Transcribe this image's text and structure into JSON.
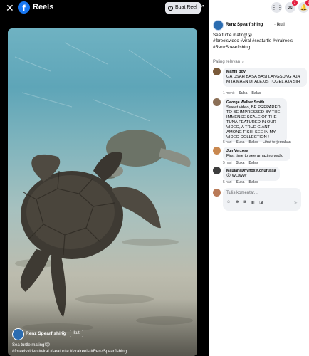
{
  "topbar": {
    "app_logo_letter": "f",
    "title": "Reels",
    "create_reel_label": "Buat Reel"
  },
  "right_topbar": {
    "notifications_badge": "1",
    "messenger_badge": "1"
  },
  "video": {
    "author": "Renz Spearfishing",
    "follow_label": "Ikuti",
    "caption_line1": "Sea turtle mating!😲",
    "caption_line2": "#fbreelsvideo #viral #seaturtle #viralreels #RenzSpearfishing"
  },
  "post": {
    "author": "Renz Spearfishing",
    "follow_label": "Ikuti",
    "caption_line1": "Sea turtle mating!😲",
    "caption_line2": "#fbreelsvideo #viral #seaturtle #viralreels",
    "caption_line3": "#RenzSpearfishing"
  },
  "comments_section": {
    "sort_label": "Paling relevan"
  },
  "comments": [
    {
      "name": "Mahfil Boy",
      "text": "GA USAH BASA BASI LANGSUNG AJA KITA MAEN DI ALEXIS TOGEL AJA SIH",
      "time": "1 menit",
      "like": "Suka",
      "reply": "Balas",
      "extra": ""
    },
    {
      "name": "George Walker Smith",
      "text": "Sweet video, BE PREPARED TO BE IMPRESSED BY THE IMMENSE SCALE OF THE TUNA FEATURED IN OUR VIDEO, A TRUE GIANT AMONG FISH. SEE IN MY VIDEO COLLECTION !",
      "time": "5 hari",
      "like": "Suka",
      "reply": "Balas",
      "extra": "Lihat terjemahan"
    },
    {
      "name": "Jun Verzosa",
      "text": "First time to see amazing vedio",
      "time": "5 hari",
      "like": "Suka",
      "reply": "Balas",
      "extra": ""
    },
    {
      "name": "MaulanaDhynox Kohurussa",
      "text": "😮 WOWW",
      "time": "5 hari",
      "like": "Suka",
      "reply": "Balas",
      "extra": ""
    }
  ],
  "comment_input": {
    "placeholder": "Tulis komentar..."
  },
  "colors": {
    "facebook_blue": "#1877f2",
    "badge_red": "#e41e3f",
    "bubble_gray": "#f0f2f5"
  }
}
